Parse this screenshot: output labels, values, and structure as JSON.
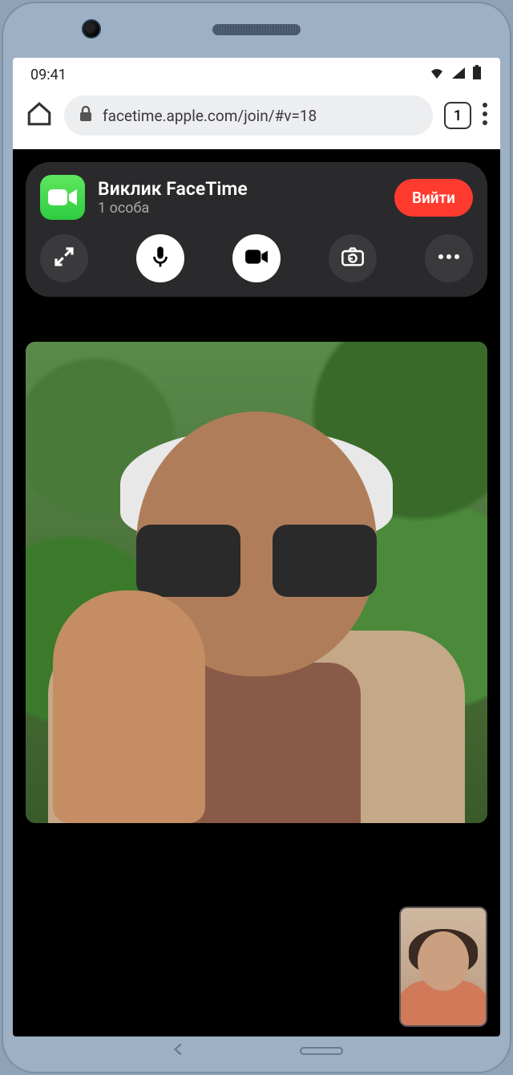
{
  "status": {
    "time": "09:41",
    "icons": {
      "wifi": "wifi-icon",
      "signal": "signal-icon",
      "battery": "battery-icon"
    }
  },
  "browser": {
    "url": "facetime.apple.com/join/#v=18",
    "tab_count": "1"
  },
  "call": {
    "title": "Виклик FaceTime",
    "subtitle": "1 особа",
    "leave_label": "Вийти",
    "controls": {
      "expand": "expand-icon",
      "mic": "mic-icon",
      "camera": "camera-icon",
      "flip": "camera-flip-icon",
      "more": "more-icon"
    }
  }
}
